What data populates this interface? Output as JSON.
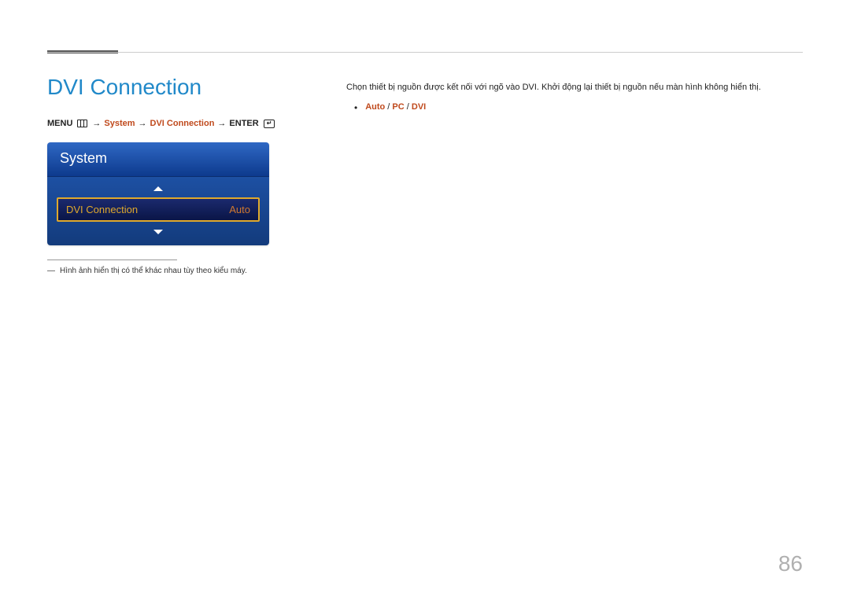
{
  "title": "DVI Connection",
  "breadcrumb": {
    "menu_label": "MENU",
    "arrow": "→",
    "path1": "System",
    "path2": "DVI Connection",
    "enter_label": "ENTER"
  },
  "osd": {
    "header": "System",
    "row_label": "DVI Connection",
    "row_value": "Auto"
  },
  "footnote": {
    "dash": "―",
    "text": "Hình ảnh hiển thị có thể khác nhau tùy theo kiểu máy."
  },
  "description": "Chọn thiết bị nguồn được kết nối với ngõ vào DVI. Khởi động lại thiết bị nguồn nếu màn hình không hiển thị.",
  "options": {
    "bullet": "•",
    "opt1": "Auto",
    "sep": " / ",
    "opt2": "PC",
    "opt3": "DVI"
  },
  "page_number": "86"
}
